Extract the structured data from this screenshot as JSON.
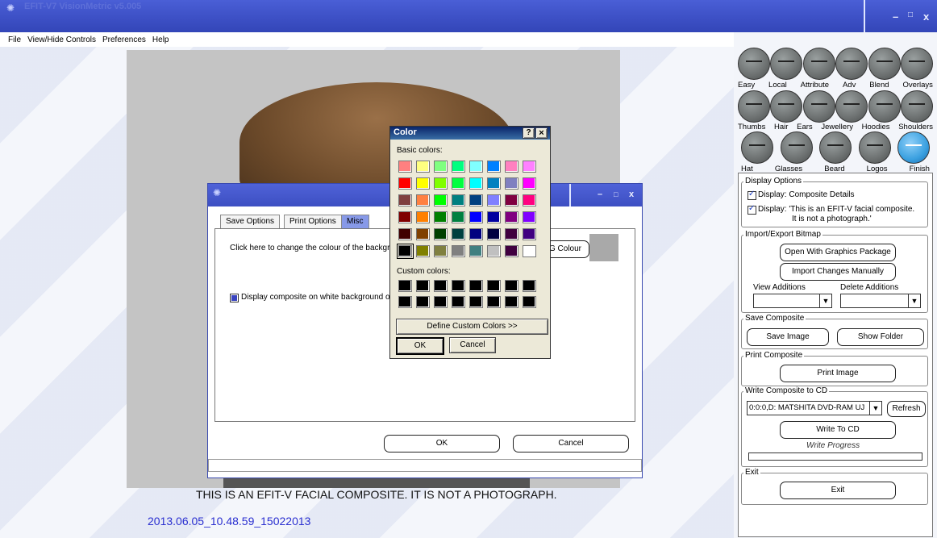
{
  "window": {
    "title": "EFIT-V7 VisionMetric v5.005",
    "minimize": "–",
    "restore": "□",
    "close": "x"
  },
  "menu": [
    "File",
    "View/Hide Controls",
    "Preferences",
    "Help"
  ],
  "composite": {
    "caption": "THIS IS AN EFIT-V FACIAL COMPOSITE. IT IS NOT A PHOTOGRAPH.",
    "stamp": "2013.06.05_10.48.59_15022013"
  },
  "tools": {
    "row1": [
      "Easy",
      "Local",
      "Attribute",
      "Adv",
      "Blend",
      "Overlays"
    ],
    "row2": [
      "Thumbs",
      "Hair",
      "Ears",
      "Jewellery",
      "Hoodies",
      "Shoulders"
    ],
    "row3": [
      "Hat",
      "Glasses",
      "Beard",
      "Logos",
      "Finish"
    ]
  },
  "options": {
    "display": {
      "title": "Display Options",
      "check1": "Display: Composite Details",
      "check2_line1": "Display: 'This is an EFIT-V facial composite.",
      "check2_line2": "It is not a photograph.'"
    },
    "bitmap": {
      "title": "Import/Export Bitmap",
      "open": "Open With Graphics Package",
      "import": "Import Changes Manually",
      "view_additions": "View Additions",
      "delete_additions": "Delete Additions"
    },
    "save": {
      "title": "Save Composite",
      "save_image": "Save Image",
      "show_folder": "Show Folder"
    },
    "print": {
      "title": "Print Composite",
      "print_image": "Print Image"
    },
    "cd": {
      "title": "Write Composite to CD",
      "drive": "0:0:0,D: MATSHITA DVD-RAM UJ",
      "refresh": "Refresh",
      "write": "Write To CD",
      "progress": "Write Progress"
    },
    "exit": {
      "title": "Exit",
      "button": "Exit"
    }
  },
  "dialog": {
    "tabs": [
      "Save Options",
      "Print Options",
      "Misc"
    ],
    "bg_text": "Click here to change the colour of the backgrou",
    "bg_button": "G Colour",
    "white_bg": "Display composite on white background on",
    "ok": "OK",
    "cancel": "Cancel",
    "swatch_color": "#a9a9a9"
  },
  "colordlg": {
    "title": "Color",
    "help": "?",
    "close": "×",
    "basic": "Basic colors:",
    "custom": "Custom colors:",
    "define": "Define Custom Colors >>",
    "ok": "OK",
    "cancel": "Cancel",
    "basic_colors": [
      "#ff8080",
      "#ffff80",
      "#80ff80",
      "#00ff80",
      "#80ffff",
      "#0080ff",
      "#ff80c0",
      "#ff80ff",
      "#ff0000",
      "#ffff00",
      "#80ff00",
      "#00ff40",
      "#00ffff",
      "#0080c0",
      "#8080c0",
      "#ff00ff",
      "#804040",
      "#ff8040",
      "#00ff00",
      "#008080",
      "#004080",
      "#8080ff",
      "#800040",
      "#ff0080",
      "#800000",
      "#ff8000",
      "#008000",
      "#008040",
      "#0000ff",
      "#0000a0",
      "#800080",
      "#8000ff",
      "#400000",
      "#804000",
      "#004000",
      "#004040",
      "#000080",
      "#000040",
      "#400040",
      "#400080",
      "#000000",
      "#808000",
      "#808040",
      "#808080",
      "#408080",
      "#c0c0c0",
      "#400040",
      "#ffffff"
    ],
    "custom_color": "#000000"
  }
}
